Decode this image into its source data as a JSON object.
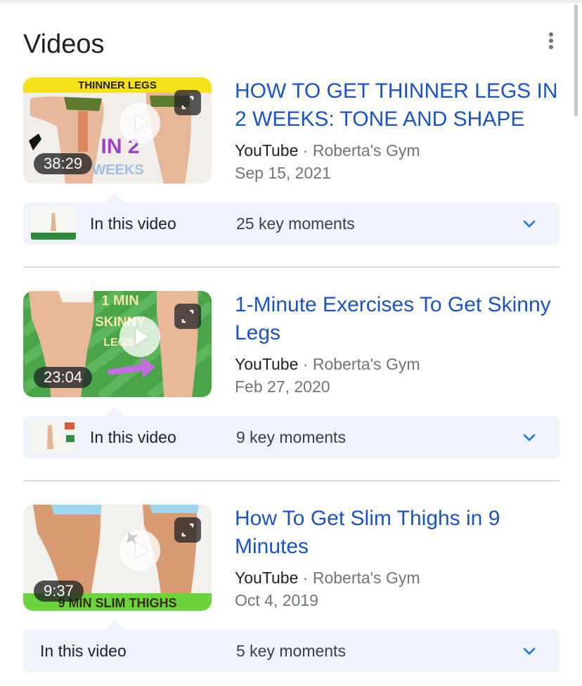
{
  "section": {
    "title": "Videos",
    "menu_icon": "more-vert-icon"
  },
  "colors": {
    "link": "#1a53c6",
    "panel": "#eef3fb",
    "text": "#202124",
    "muted": "#70757a"
  },
  "videos": [
    {
      "title": "HOW TO GET THINNER LEGS IN 2 WEEKS: TONE AND SHAPE",
      "source": "YouTube",
      "separator": " · ",
      "channel": "Roberta's Gym",
      "date": "Sep 15, 2021",
      "duration": "38:29",
      "moments_label": "In this video",
      "moments_count": "25 key moments",
      "thumb_text_top": "THINNER LEGS",
      "thumb_text_mid": "IN 2",
      "thumb_text_bottom": "WEEKS"
    },
    {
      "title": "1-Minute Exercises To Get Skinny Legs",
      "source": "YouTube",
      "separator": " · ",
      "channel": "Roberta's Gym",
      "date": "Feb 27, 2020",
      "duration": "23:04",
      "moments_label": "In this video",
      "moments_count": "9 key moments",
      "thumb_text_top": "1 MIN",
      "thumb_text_mid": "SKINNY",
      "thumb_text_bottom": "LEGS"
    },
    {
      "title": "How To Get Slim Thighs in 9 Minutes",
      "source": "YouTube",
      "separator": " · ",
      "channel": "Roberta's Gym",
      "date": "Oct 4, 2019",
      "duration": "9:37",
      "moments_label": "In this video",
      "moments_count": "5 key moments",
      "thumb_text_bottom": "9 MIN SLIM THIGHS"
    }
  ]
}
